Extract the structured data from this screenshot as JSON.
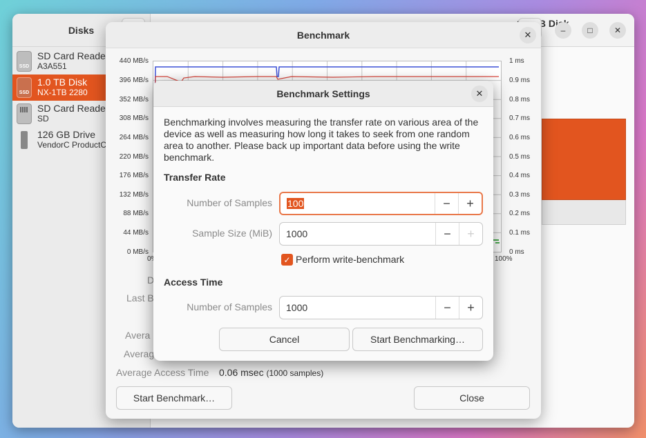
{
  "disks_window": {
    "sidebar_title": "Disks",
    "drives": [
      {
        "name": "SD Card Reader",
        "sub": "A3A551",
        "icon": "ssd-drive-icon",
        "badge": "SSD"
      },
      {
        "name": "1.0 TB Disk",
        "sub": "NX-1TB 2280",
        "icon": "ssd-drive-icon",
        "badge": "SSD",
        "selected": true
      },
      {
        "name": "SD Card Reader",
        "sub": "SD",
        "icon": "sd-card-icon",
        "badge": ""
      },
      {
        "name": "126 GB Drive",
        "sub": "VendorC ProductC",
        "icon": "usb-drive-icon",
        "badge": ""
      }
    ],
    "title": "1.0 TB Disk",
    "window_buttons": {
      "minimize": "–",
      "maximize": "□",
      "close": "✕"
    }
  },
  "benchmark_window": {
    "title": "Benchmark",
    "close_glyph": "✕",
    "left_axis": [
      "440 MB/s",
      "396 MB/s",
      "352 MB/s",
      "308 MB/s",
      "264 MB/s",
      "220 MB/s",
      "176 MB/s",
      "132 MB/s",
      "88 MB/s",
      "44 MB/s",
      "0 MB/s"
    ],
    "right_axis": [
      "1 ms",
      "0.9 ms",
      "0.8 ms",
      "0.7 ms",
      "0.6 ms",
      "0.5 ms",
      "0.4 ms",
      "0.3 ms",
      "0.2 ms",
      "0.1 ms",
      "0 ms"
    ],
    "x_start": "0%",
    "x_end": "100%",
    "partial_labels": [
      "D",
      "Last B",
      "Avera",
      "Averag"
    ],
    "avg_access_label": "Average Access Time",
    "avg_access_value": "0.06 msec",
    "avg_access_samples": "(1000 samples)",
    "start_button": "Start Benchmark…",
    "close_button": "Close",
    "colors": {
      "read": "#3b4fd6",
      "write": "#d9443a",
      "access": "#4caf50"
    }
  },
  "settings_dialog": {
    "title": "Benchmark Settings",
    "close_glyph": "✕",
    "description": "Benchmarking involves measuring the transfer rate on various area of the device as well as measuring how long it takes to seek from one random area to another. Please back up important data before using the write benchmark.",
    "transfer_rate": {
      "title": "Transfer Rate",
      "num_samples_label": "Number of Samples",
      "num_samples_value": "100",
      "sample_size_label": "Sample Size (MiB)",
      "sample_size_value": "1000"
    },
    "write_benchmark": {
      "label": "Perform write-benchmark",
      "checked": true,
      "check_glyph": "✓"
    },
    "access_time": {
      "title": "Access Time",
      "num_samples_label": "Number of Samples",
      "num_samples_value": "1000"
    },
    "spin_minus": "−",
    "spin_plus": "+",
    "cancel": "Cancel",
    "start": "Start Benchmarking…",
    "accent": "#e2551f"
  }
}
